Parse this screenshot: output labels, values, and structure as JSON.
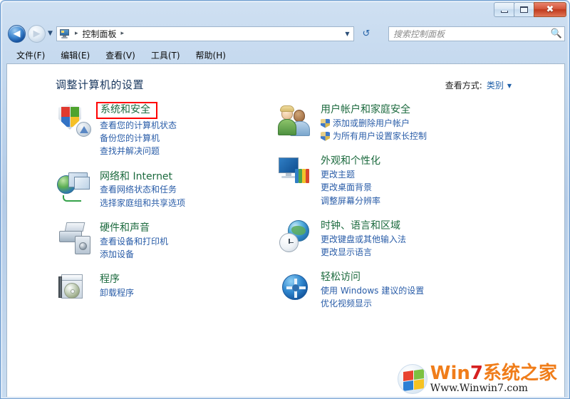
{
  "window": {
    "buttons": {
      "minimize": "–",
      "maximize": "▭",
      "close": "✖"
    }
  },
  "nav": {
    "back_icon": "◀",
    "forward_icon": "▶",
    "recent_caret": "▼",
    "address_icon": "control-panel-icon",
    "breadcrumb": [
      {
        "label": "控制面板"
      }
    ],
    "separator": "▸",
    "dropdown_caret": "▼",
    "refresh_icon": "↺"
  },
  "search": {
    "placeholder": "搜索控制面板",
    "value": "",
    "icon": "🔍"
  },
  "menubar": {
    "items": [
      {
        "label": "文件(F)"
      },
      {
        "label": "编辑(E)"
      },
      {
        "label": "查看(V)"
      },
      {
        "label": "工具(T)"
      },
      {
        "label": "帮助(H)"
      }
    ]
  },
  "content": {
    "page_title": "调整计算机的设置",
    "view_by": {
      "label": "查看方式:",
      "value": "类别",
      "caret": "▼"
    }
  },
  "categories": {
    "left": [
      {
        "icon": "security-shield-icon",
        "title": "系统和安全",
        "highlighted": true,
        "links": [
          {
            "label": "查看您的计算机状态",
            "shield": false
          },
          {
            "label": "备份您的计算机",
            "shield": false
          },
          {
            "label": "查找并解决问题",
            "shield": false
          }
        ]
      },
      {
        "icon": "network-globe-icon",
        "title": "网络和 Internet",
        "highlighted": false,
        "links": [
          {
            "label": "查看网络状态和任务",
            "shield": false
          },
          {
            "label": "选择家庭组和共享选项",
            "shield": false
          }
        ]
      },
      {
        "icon": "printer-speaker-icon",
        "title": "硬件和声音",
        "highlighted": false,
        "links": [
          {
            "label": "查看设备和打印机",
            "shield": false
          },
          {
            "label": "添加设备",
            "shield": false
          }
        ]
      },
      {
        "icon": "programs-box-icon",
        "title": "程序",
        "highlighted": false,
        "links": [
          {
            "label": "卸载程序",
            "shield": false
          }
        ]
      }
    ],
    "right": [
      {
        "icon": "user-accounts-icon",
        "title": "用户帐户和家庭安全",
        "highlighted": false,
        "links": [
          {
            "label": "添加或删除用户帐户",
            "shield": true
          },
          {
            "label": "为所有用户设置家长控制",
            "shield": true
          }
        ]
      },
      {
        "icon": "appearance-display-icon",
        "title": "外观和个性化",
        "highlighted": false,
        "links": [
          {
            "label": "更改主题",
            "shield": false
          },
          {
            "label": "更改桌面背景",
            "shield": false
          },
          {
            "label": "调整屏幕分辨率",
            "shield": false
          }
        ]
      },
      {
        "icon": "clock-language-icon",
        "title": "时钟、语言和区域",
        "highlighted": false,
        "links": [
          {
            "label": "更改键盘或其他输入法",
            "shield": false
          },
          {
            "label": "更改显示语言",
            "shield": false
          }
        ]
      },
      {
        "icon": "ease-of-access-icon",
        "title": "轻松访问",
        "highlighted": false,
        "links": [
          {
            "label": "使用 Windows 建议的设置",
            "shield": false
          },
          {
            "label": "优化视频显示",
            "shield": false
          }
        ]
      }
    ]
  },
  "watermark": {
    "brand_win": "Win",
    "brand_seven": "7",
    "brand_cn": "系统之家",
    "url": "Www.Winwin7.com"
  },
  "colors": {
    "category_title": "#1c6a3e",
    "link": "#2a5da8",
    "page_title": "#17365d",
    "highlight_box": "#ff0000",
    "close_button": "#c03a1d"
  }
}
